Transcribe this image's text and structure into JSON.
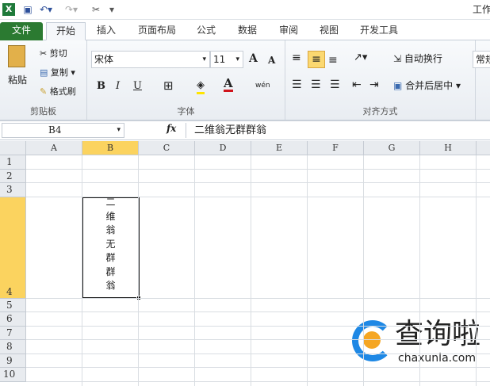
{
  "title": "工作",
  "tabs": [
    "文件",
    "开始",
    "插入",
    "页面布局",
    "公式",
    "数据",
    "审阅",
    "视图",
    "开发工具"
  ],
  "clipboard": {
    "paste": "粘贴",
    "cut": "剪切",
    "copy": "复制",
    "format_painter": "格式刷",
    "label": "剪贴板"
  },
  "font": {
    "name": "宋体",
    "size": "11",
    "bold": "B",
    "italic": "I",
    "underline": "U",
    "grow": "A",
    "shrink": "A",
    "font_color": "A",
    "phonetic": "wén",
    "label": "字体"
  },
  "align": {
    "wrap": "自动换行",
    "merge": "合并后居中",
    "label": "对齐方式"
  },
  "number": {
    "format": "常规"
  },
  "formula": {
    "name_box": "B4",
    "fx": "fx",
    "content": "二维翁无群群翁"
  },
  "columns": [
    "A",
    "B",
    "C",
    "D",
    "E",
    "F",
    "G",
    "H"
  ],
  "rows": [
    "1",
    "2",
    "3",
    "4",
    "5",
    "6",
    "7",
    "8",
    "9",
    "10"
  ],
  "cell_b4": [
    "二",
    "维",
    "翁",
    "无",
    "群",
    "群",
    "翁"
  ],
  "watermark": {
    "text": "查询啦",
    "url": "chaxunla.com"
  },
  "colors": {
    "file_tab": "#2b7a31",
    "selection": "#fbd35f",
    "accent_blue": "#1e88e5",
    "accent_orange": "#f5a623"
  }
}
